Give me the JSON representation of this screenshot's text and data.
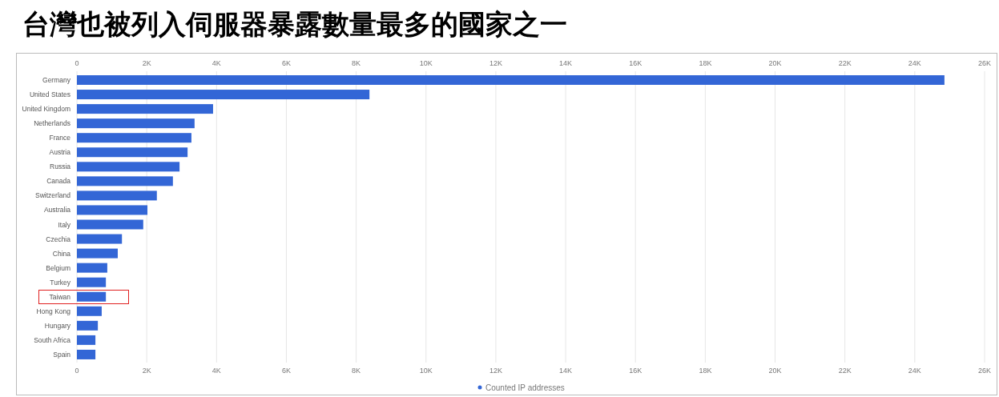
{
  "title": "台灣也被列入伺服器暴露數量最多的國家之一",
  "chart_data": {
    "type": "bar",
    "orientation": "horizontal",
    "categories": [
      "Germany",
      "United States",
      "United Kingdom",
      "Netherlands",
      "France",
      "Austria",
      "Russia",
      "Canada",
      "Switzerland",
      "Australia",
      "Italy",
      "Czechia",
      "China",
      "Belgium",
      "Turkey",
      "Taiwan",
      "Hong Kong",
      "Hungary",
      "South Africa",
      "Spain"
    ],
    "series": [
      {
        "name": "Counted IP addresses",
        "color": "#3366d6",
        "values": [
          24850,
          8380,
          3900,
          3370,
          3280,
          3170,
          2940,
          2750,
          2290,
          2020,
          1900,
          1290,
          1170,
          870,
          830,
          830,
          710,
          600,
          530,
          530
        ]
      }
    ],
    "xlim": [
      0,
      26000
    ],
    "xticks": [
      {
        "value": 0,
        "label": "0"
      },
      {
        "value": 2000,
        "label": "2K"
      },
      {
        "value": 4000,
        "label": "4K"
      },
      {
        "value": 6000,
        "label": "6K"
      },
      {
        "value": 8000,
        "label": "8K"
      },
      {
        "value": 10000,
        "label": "10K"
      },
      {
        "value": 12000,
        "label": "12K"
      },
      {
        "value": 14000,
        "label": "14K"
      },
      {
        "value": 16000,
        "label": "16K"
      },
      {
        "value": 18000,
        "label": "18K"
      },
      {
        "value": 20000,
        "label": "20K"
      },
      {
        "value": 22000,
        "label": "22K"
      },
      {
        "value": 24000,
        "label": "24K"
      },
      {
        "value": 26000,
        "label": "26K"
      }
    ],
    "grid": true
  },
  "label_highlight": {
    "color": "#e02020",
    "rows": [
      {
        "on": false
      },
      {
        "on": false
      },
      {
        "on": false
      },
      {
        "on": false
      },
      {
        "on": false
      },
      {
        "on": false
      },
      {
        "on": false
      },
      {
        "on": false
      },
      {
        "on": false
      },
      {
        "on": false
      },
      {
        "on": false
      },
      {
        "on": false
      },
      {
        "on": false
      },
      {
        "on": false
      },
      {
        "on": false
      },
      {
        "on": true
      },
      {
        "on": false
      },
      {
        "on": false
      },
      {
        "on": false
      },
      {
        "on": false
      }
    ]
  }
}
